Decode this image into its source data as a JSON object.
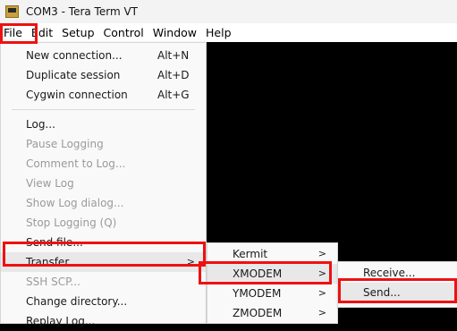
{
  "window": {
    "title": "COM3 - Tera Term VT"
  },
  "menubar": [
    "File",
    "Edit",
    "Setup",
    "Control",
    "Window",
    "Help"
  ],
  "file_menu": {
    "group1": [
      {
        "label": "New connection...",
        "shortcut": "Alt+N"
      },
      {
        "label": "Duplicate session",
        "shortcut": "Alt+D"
      },
      {
        "label": "Cygwin connection",
        "shortcut": "Alt+G"
      }
    ],
    "group2": [
      {
        "label": "Log...",
        "enabled": true
      },
      {
        "label": "Pause Logging",
        "enabled": false
      },
      {
        "label": "Comment to Log...",
        "enabled": false
      },
      {
        "label": "View Log",
        "enabled": false
      },
      {
        "label": "Show Log dialog...",
        "enabled": false
      },
      {
        "label": "Stop Logging (Q)",
        "enabled": false
      },
      {
        "label": "Send file...",
        "enabled": true
      },
      {
        "label": "Transfer",
        "enabled": true,
        "arrow": ">"
      },
      {
        "label": "SSH SCP...",
        "enabled": false
      },
      {
        "label": "Change directory...",
        "enabled": true
      },
      {
        "label": "Replay Log...",
        "enabled": true
      }
    ]
  },
  "transfer_submenu": [
    {
      "label": "Kermit",
      "arrow": ">"
    },
    {
      "label": "XMODEM",
      "arrow": ">"
    },
    {
      "label": "YMODEM",
      "arrow": ">"
    },
    {
      "label": "ZMODEM",
      "arrow": ">"
    }
  ],
  "xmodem_submenu": [
    {
      "label": "Receive..."
    },
    {
      "label": "Send..."
    }
  ],
  "colors": {
    "highlight_box": "#ee1111",
    "terminal_bg": "#000000",
    "menu_bg": "#f9f9f9"
  }
}
